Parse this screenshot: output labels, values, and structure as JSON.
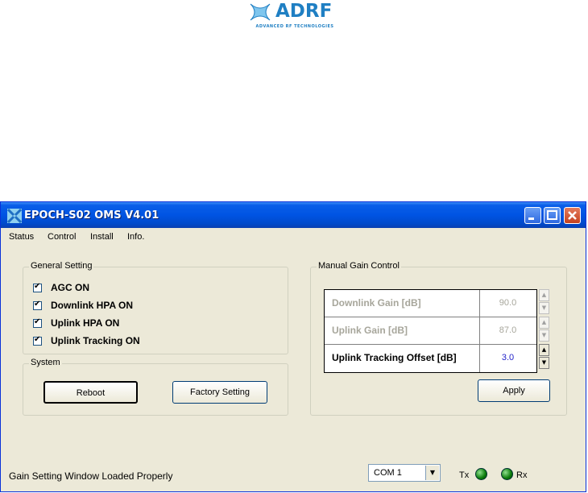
{
  "logo": {
    "name": "ADRF",
    "subtitle": "ADVANCED RF TECHNOLOGIES"
  },
  "window": {
    "title": "EPOCH-S02 OMS V4.01"
  },
  "menu": [
    "Status",
    "Control",
    "Install",
    "Info."
  ],
  "general_setting": {
    "legend": "General Setting",
    "items": [
      {
        "label": "AGC ON",
        "checked": true
      },
      {
        "label": "Downlink HPA ON",
        "checked": true
      },
      {
        "label": "Uplink HPA ON",
        "checked": true
      },
      {
        "label": "Uplink Tracking ON",
        "checked": true
      }
    ]
  },
  "system": {
    "legend": "System",
    "reboot_label": "Reboot",
    "factory_label": "Factory Setting"
  },
  "manual_gain": {
    "legend": "Manual Gain Control",
    "rows": [
      {
        "label": "Downlink Gain [dB]",
        "value": "90.0",
        "enabled": false
      },
      {
        "label": "Uplink Gain [dB]",
        "value": "87.0",
        "enabled": false
      },
      {
        "label": "Uplink Tracking Offset [dB]",
        "value": "3.0",
        "enabled": true
      }
    ],
    "apply_label": "Apply"
  },
  "status": {
    "message": "Gain Setting Window Loaded Properly",
    "com_port": "COM 1",
    "tx_label": "Tx",
    "rx_label": "Rx"
  },
  "colors": {
    "accent": "#0054e3",
    "enabled_value": "#1f1fc8",
    "disabled_text": "#a7a69b",
    "led": "#0a7a0a"
  }
}
